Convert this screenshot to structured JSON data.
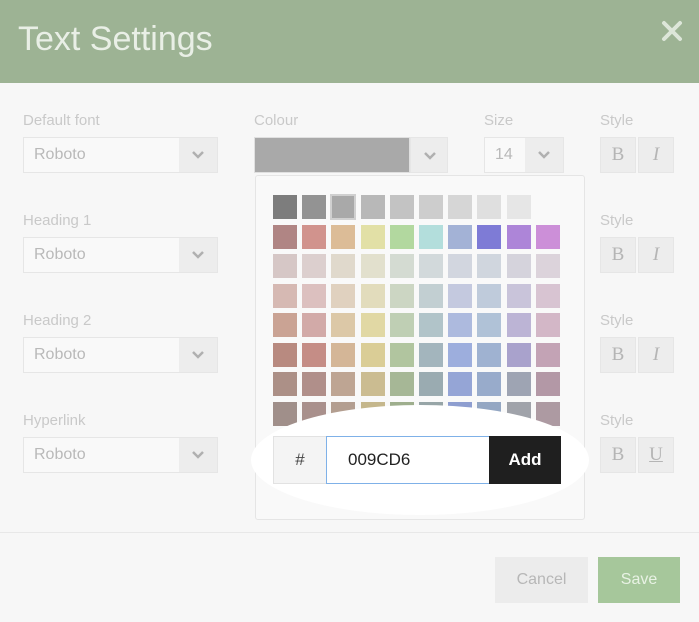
{
  "dialog": {
    "title": "Text Settings",
    "close_icon": "close-icon"
  },
  "fields": {
    "default_font": {
      "label": "Default font",
      "value": "Roboto"
    },
    "colour": {
      "label": "Colour",
      "value_color": "#a9a9a9"
    },
    "size": {
      "label": "Size",
      "value": "14"
    },
    "heading1": {
      "label": "Heading 1",
      "value": "Roboto"
    },
    "heading2": {
      "label": "Heading 2",
      "value": "Roboto"
    },
    "hyperlink": {
      "label": "Hyperlink",
      "value": "Roboto"
    }
  },
  "style": {
    "label": "Style",
    "bold": "B",
    "italic": "I",
    "underline": "U"
  },
  "picker": {
    "hash": "#",
    "hex_value": "009CD6",
    "add_label": "Add",
    "swatches": [
      [
        "#7d7d7d",
        "#939393",
        "#a9a9a9",
        "#b8b8b8",
        "#c3c3c3",
        "#cdcdcd",
        "#d6d6d6",
        "#dfdfdf",
        "#e6e6e6"
      ],
      [
        "#b08584",
        "#d1938d",
        "#dcbc97",
        "#e2e0a6",
        "#b2d89f",
        "#b3dedc",
        "#a3b2d6",
        "#7e7bd6",
        "#ad85d8",
        "#cc8fd8"
      ],
      [
        "#d6c7c6",
        "#dccfce",
        "#e0d9cc",
        "#e2e0cd",
        "#d4dbd2",
        "#d2d9db",
        "#d2d6df",
        "#d0d6de",
        "#d5d3dc",
        "#dcd3db"
      ],
      [
        "#d6b9b3",
        "#dcc0bf",
        "#e0d1bf",
        "#e2dcbc",
        "#ccd6c3",
        "#c2cfd2",
        "#c4c9df",
        "#bfcbdb",
        "#c9c4da",
        "#d8c4d2"
      ],
      [
        "#caa394",
        "#d2aaa8",
        "#dcc8a7",
        "#e1d8a4",
        "#bfcfb4",
        "#b1c4c9",
        "#adbade",
        "#b0c2d7",
        "#bcb4d5",
        "#d3b7c7"
      ],
      [
        "#b88a80",
        "#c58d86",
        "#d4b697",
        "#dacd96",
        "#b1c59f",
        "#a3b5bd",
        "#9daedd",
        "#9fb2d1",
        "#a9a2cc",
        "#c3a3b5"
      ],
      [
        "#ac9087",
        "#b08f8a",
        "#bea593",
        "#cbbc91",
        "#a6b796",
        "#9aabb1",
        "#95a5d6",
        "#98abcb",
        "#9ea4b3",
        "#b398a6"
      ],
      [
        "#a08f8a",
        "#a9908c",
        "#b39e90",
        "#c5b78c",
        "#9eae8d",
        "#97a5a7",
        "#8e9ed0",
        "#94a7c3",
        "#a0a3aa",
        "#ad9aa2"
      ]
    ]
  },
  "footer": {
    "cancel_label": "Cancel",
    "save_label": "Save"
  }
}
